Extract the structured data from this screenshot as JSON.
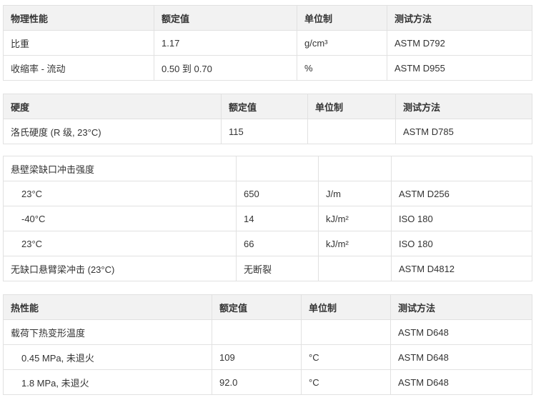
{
  "physical": {
    "headers": [
      "物理性能",
      "额定值",
      "单位制",
      "测试方法"
    ],
    "rows": [
      [
        "比重",
        "1.17",
        "g/cm³",
        "ASTM D792"
      ],
      [
        "收缩率 - 流动",
        "0.50 到 0.70",
        "%",
        "ASTM D955"
      ]
    ]
  },
  "hardness": {
    "headers": [
      "硬度",
      "额定值",
      "单位制",
      "测试方法"
    ],
    "rows": [
      [
        "洛氏硬度 (R 级, 23°C)",
        "115",
        "",
        "ASTM D785"
      ]
    ]
  },
  "impact": {
    "rows": [
      [
        "悬壁梁缺口冲击强度",
        "",
        "",
        ""
      ],
      [
        "23°C",
        "650",
        "J/m",
        "ASTM D256"
      ],
      [
        "-40°C",
        "14",
        "kJ/m²",
        "ISO 180"
      ],
      [
        "23°C",
        "66",
        "kJ/m²",
        "ISO 180"
      ],
      [
        "无缺口悬臂梁冲击 (23°C)",
        "无断裂",
        "",
        "ASTM D4812"
      ]
    ]
  },
  "thermal": {
    "headers": [
      "热性能",
      "额定值",
      "单位制",
      "测试方法"
    ],
    "rows": [
      [
        "载荷下热变形温度",
        "",
        "",
        "ASTM D648"
      ],
      [
        "0.45 MPa, 未退火",
        "109",
        "°C",
        "ASTM D648"
      ],
      [
        "1.8 MPa, 未退火",
        "92.0",
        "°C",
        "ASTM D648"
      ]
    ]
  }
}
